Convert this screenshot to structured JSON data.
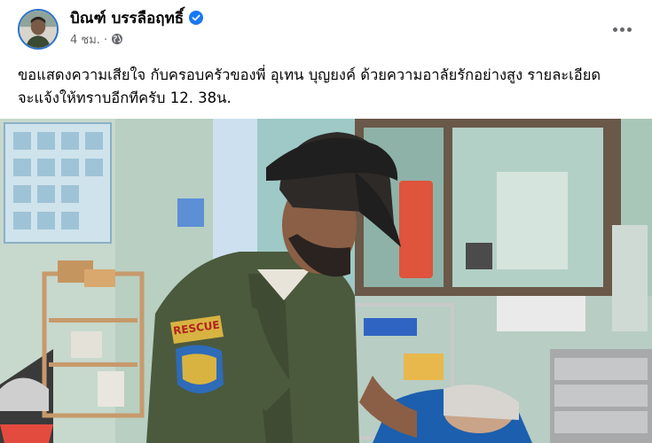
{
  "post": {
    "author": "บิณฑ์ บรรลือฤทธิ์",
    "verified_icon": "verified-badge-icon",
    "time": "4 ชม.",
    "separator": "·",
    "audience_icon": "globe-icon",
    "more_icon": "more-options-icon",
    "text": "ขอแสดงความเสียใจ กับครอบครัวของพี่ อุเทน บุญยงค์ ด้วยความอาลัยรักอย่างสูง รายละเอียดจะแจ้งให้ทราบอีกทีครับ 12. 38น."
  },
  "photo": {
    "patch_text": "RESCUE"
  },
  "colors": {
    "verified": "#1877f2",
    "name": "#050505",
    "meta": "#65676b",
    "wall": "#a9c7b9",
    "uniform": "#4b5a3c"
  }
}
